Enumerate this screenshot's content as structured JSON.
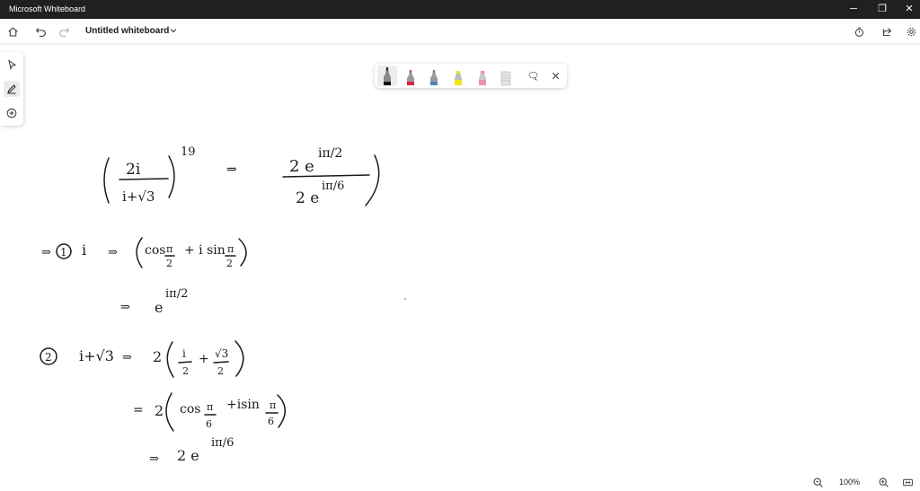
{
  "window": {
    "title": "Microsoft Whiteboard",
    "controls": {
      "minimize": "─",
      "restore": "❐",
      "close": "✕"
    }
  },
  "toolbar": {
    "board_title": "Untitled whiteboard"
  },
  "inkbar": {
    "pens": [
      {
        "name": "black-pen",
        "color": "#1b1b1b"
      },
      {
        "name": "red-pen",
        "color": "#d9233c"
      },
      {
        "name": "blue-pen",
        "color": "#4c82b6"
      },
      {
        "name": "yellow-highlighter",
        "color": "#f3e61c"
      },
      {
        "name": "pink-highlighter",
        "color": "#ee8fb0"
      },
      {
        "name": "eraser",
        "color": "#d6d6d6"
      }
    ],
    "active": "black-pen"
  },
  "canvas": {
    "lines": [
      {
        "id": "eq-top-left",
        "text": "(2i / (i+√3))^19"
      },
      {
        "id": "eq-top-right",
        "text": "⇒ 2e^(iπ/2) / 2e^(iπ/6)"
      },
      {
        "id": "step1-label",
        "text": "⇒ ① i ⇒ (cos π/2 + i sin π/2)"
      },
      {
        "id": "step1-result",
        "text": "⇒ e^(iπ/2)"
      },
      {
        "id": "step2-label",
        "text": "② i+√3 ⇒ 2(i/2 + √3/2)"
      },
      {
        "id": "step2-polar",
        "text": "= 2(cos π/6 + i sin π/6)"
      },
      {
        "id": "step2-result",
        "text": "⇒ 2e^(iπ/6)"
      }
    ],
    "glyphs": {
      "two": "2",
      "i": "i",
      "i_plus_root3": "i+√3",
      "nineteen": "19",
      "implies": "⇒",
      "two_e": "2 e",
      "pi_over_2": "π/2",
      "pi_over_6": "π/6",
      "one_circled": "1",
      "two_circled": "2",
      "cos": "cos",
      "sin": "sin",
      "plus_i_sin": "+ i sin",
      "plus_isin": "+isin",
      "pi": "π",
      "over2": "2",
      "over6": "6",
      "e": "e",
      "equals": "=",
      "i_over_2": "i",
      "root3": "√3",
      "plus": "+"
    }
  },
  "zoom": {
    "level": "100%"
  }
}
